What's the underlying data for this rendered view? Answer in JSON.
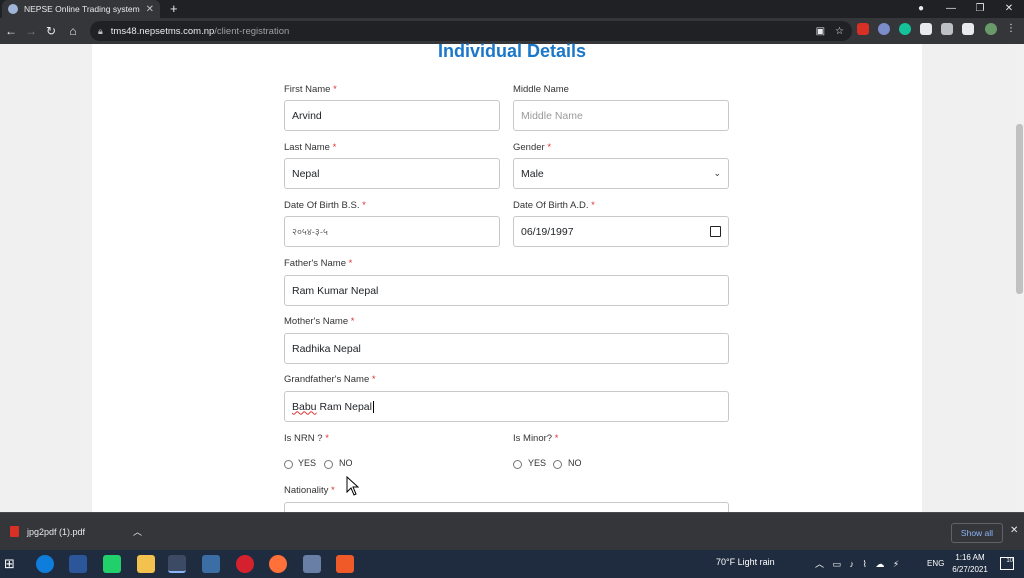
{
  "browser": {
    "tab_title": "NEPSE Online Trading system",
    "url_host": "tms48.nepsetms.com.np",
    "url_path": "/client-registration"
  },
  "form": {
    "heading": "Individual Details",
    "first_name": {
      "label": "First Name",
      "value": "Arvind"
    },
    "middle_name": {
      "label": "Middle Name",
      "placeholder": "Middle Name"
    },
    "last_name": {
      "label": "Last Name",
      "value": "Nepal"
    },
    "gender": {
      "label": "Gender",
      "value": "Male"
    },
    "dob_bs": {
      "label": "Date Of Birth B.S.",
      "value": "२०५४-३-५"
    },
    "dob_ad": {
      "label": "Date Of Birth A.D.",
      "value": "06/19/1997"
    },
    "father_name": {
      "label": "Father's Name",
      "value": "Ram Kumar Nepal"
    },
    "mother_name": {
      "label": "Mother's Name",
      "value": "Radhika Nepal"
    },
    "grandfather_name": {
      "label": "Grandfather's Name",
      "value_part1": "Babu",
      "value_part2": " Ram Nepal"
    },
    "is_nrn": {
      "label": "Is NRN ?",
      "yes": "YES",
      "no": "NO"
    },
    "is_minor": {
      "label": "Is Minor?",
      "yes": "YES",
      "no": "NO"
    },
    "nationality": {
      "label": "Nationality"
    },
    "required_mark": "*"
  },
  "download_bar": {
    "file_name": "jpg2pdf (1).pdf",
    "show_all": "Show all"
  },
  "taskbar": {
    "weather": "70°F  Light rain",
    "lang": "ENG",
    "time": "1:16 AM",
    "date": "6/27/2021",
    "notif_count": "10"
  }
}
